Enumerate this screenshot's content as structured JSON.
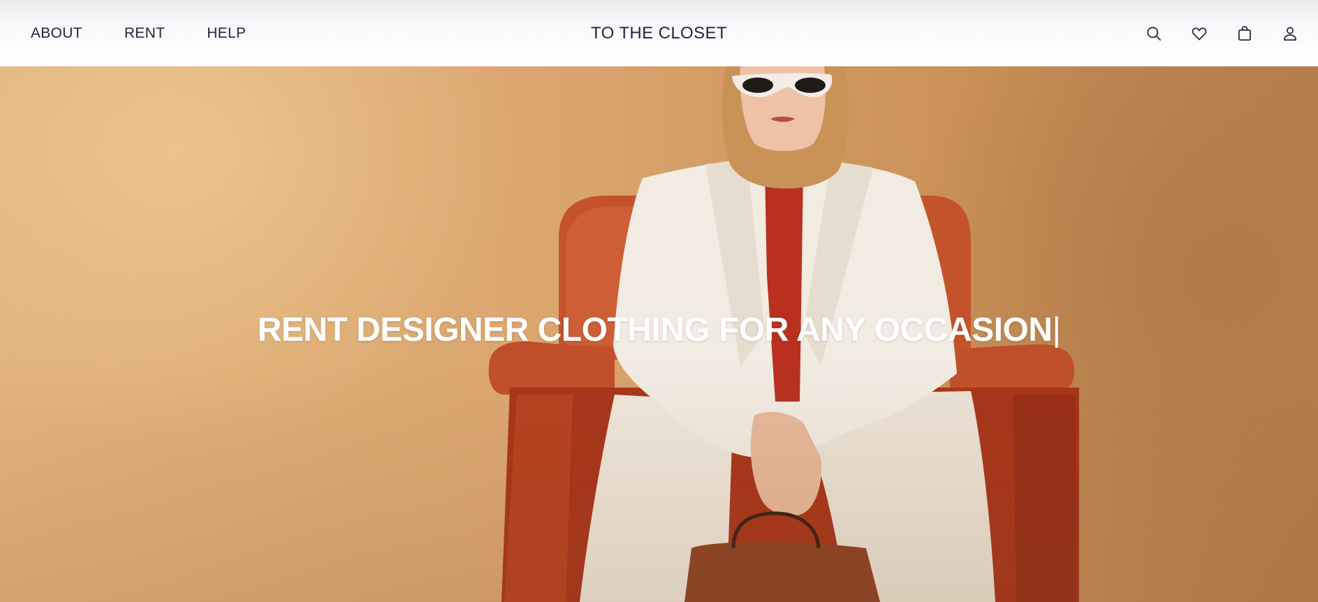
{
  "header": {
    "nav": [
      {
        "label": "ABOUT"
      },
      {
        "label": "RENT"
      },
      {
        "label": "HELP"
      }
    ],
    "brand": "TO THE CLOSET",
    "icons": [
      "search-icon",
      "heart-icon",
      "bag-icon",
      "user-icon"
    ]
  },
  "hero": {
    "headline": "RENT DESIGNER CLOTHING FOR ANY OCCASION",
    "cursor": "|",
    "image": "model-in-white-suit-on-orange-armchair"
  },
  "colors": {
    "nav_text": "#22273a",
    "hero_text": "#ffffff",
    "hero_background": "#dba670",
    "armchair": "#c04a25"
  }
}
